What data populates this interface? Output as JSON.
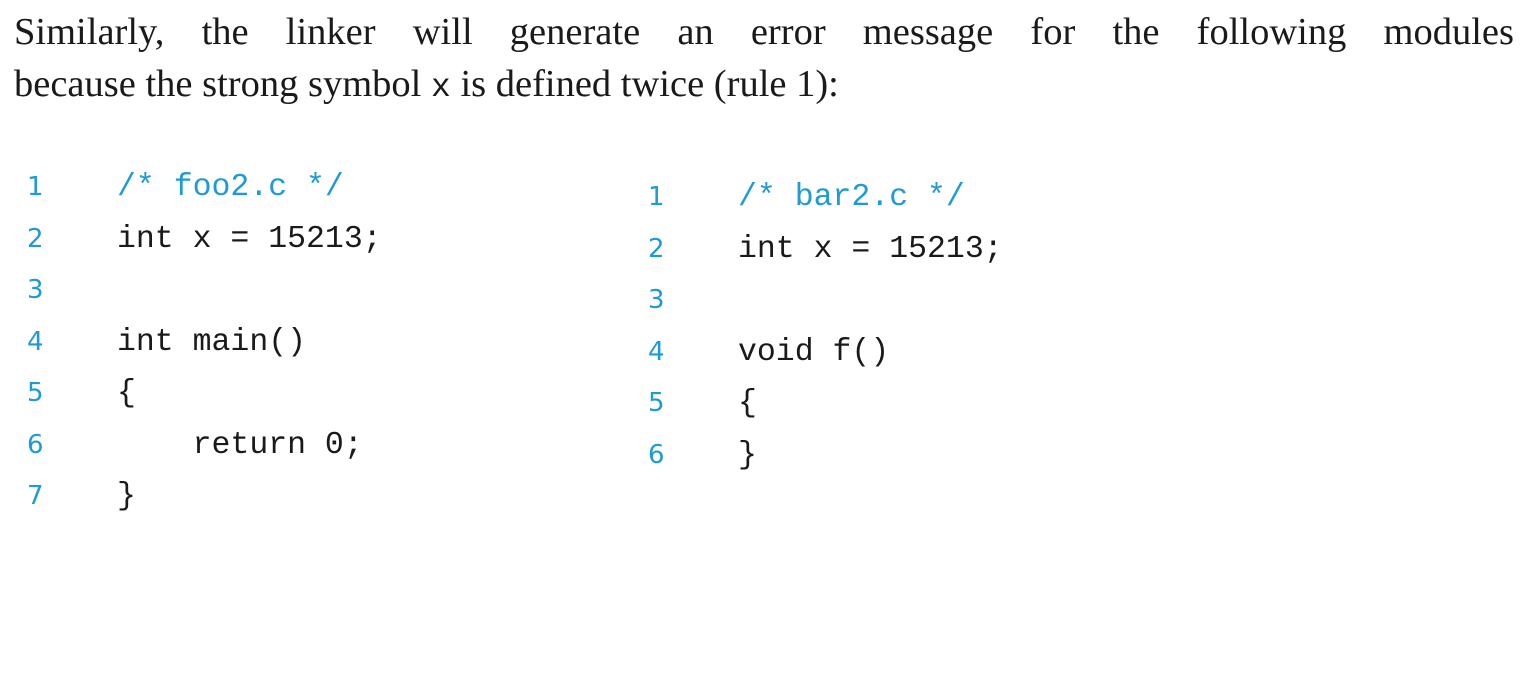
{
  "prose": {
    "line1": "Similarly, the linker will generate an error message for the following modules",
    "line2_before": "because the strong symbol ",
    "line2_code": "x",
    "line2_after": " is defined twice (rule 1):"
  },
  "listings": {
    "left": {
      "lines": [
        {
          "num": "1",
          "code": "/* foo2.c */"
        },
        {
          "num": "2",
          "code": "int x = 15213;"
        },
        {
          "num": "3",
          "code": ""
        },
        {
          "num": "4",
          "code": "int main()"
        },
        {
          "num": "5",
          "code": "{"
        },
        {
          "num": "6",
          "code": "    return 0;"
        },
        {
          "num": "7",
          "code": "}"
        }
      ]
    },
    "right": {
      "lines": [
        {
          "num": "1",
          "code": "/* bar2.c */"
        },
        {
          "num": "2",
          "code": "int x = 15213;"
        },
        {
          "num": "3",
          "code": ""
        },
        {
          "num": "4",
          "code": "void f()"
        },
        {
          "num": "5",
          "code": "{"
        },
        {
          "num": "6",
          "code": "}"
        }
      ]
    }
  },
  "colors": {
    "line_number": "#1e9ad6",
    "comment": "#1e9ad6",
    "text": "#1a1a1a"
  }
}
